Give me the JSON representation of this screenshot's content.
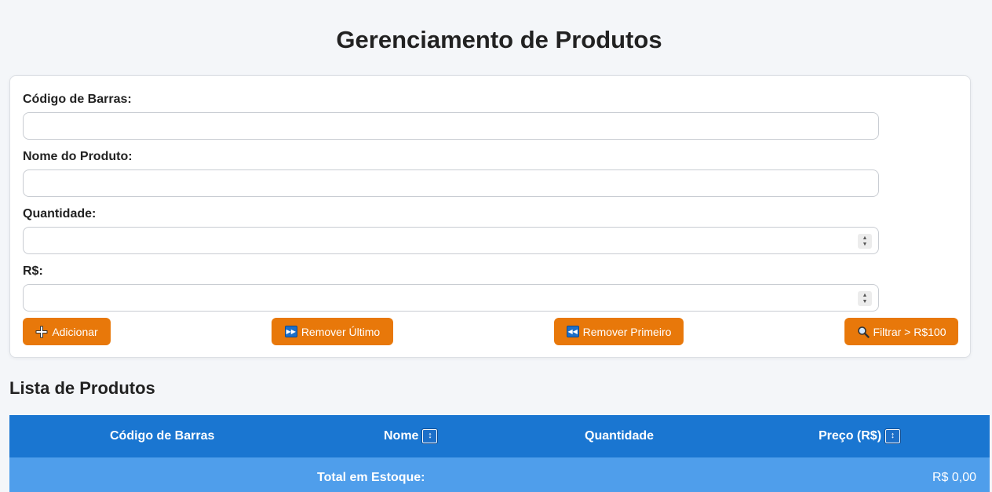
{
  "title": "Gerenciamento de Produtos",
  "form": {
    "fields": [
      {
        "label": "Código de Barras:",
        "value": "",
        "placeholder": ""
      },
      {
        "label": "Nome do Produto:",
        "value": "",
        "placeholder": ""
      },
      {
        "label": "Quantidade:",
        "value": "",
        "placeholder": ""
      },
      {
        "label": "R$:",
        "value": "",
        "placeholder": ""
      }
    ],
    "buttons": {
      "add": {
        "label": "Adicionar",
        "icon": "plus-icon"
      },
      "remove_last": {
        "label": "Remover Último",
        "icon": "fast-forward-icon"
      },
      "remove_first": {
        "label": "Remover Primeiro",
        "icon": "rewind-icon"
      },
      "filter": {
        "label": "Filtrar > R$100",
        "icon": "magnifier-icon"
      }
    }
  },
  "list": {
    "title": "Lista de Produtos",
    "columns": [
      "Código de Barras",
      "Nome",
      "Quantidade",
      "Preço (R$)"
    ],
    "rows": [],
    "total_label": "Total em Estoque:",
    "total_value": "R$ 0,00"
  },
  "colors": {
    "accent": "#e8780a",
    "header": "#1a76d1",
    "footer": "#4f9eeb",
    "background": "#f4f6f9"
  }
}
